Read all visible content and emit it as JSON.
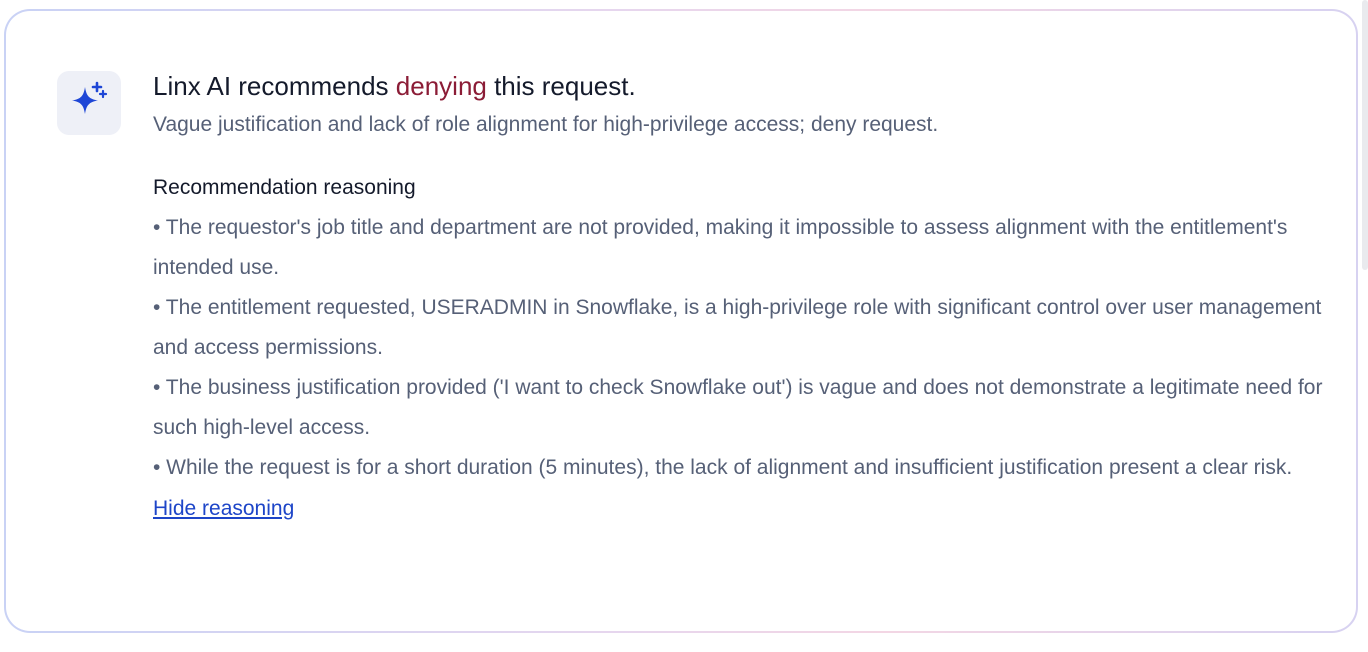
{
  "recommendation": {
    "headline_prefix": "Linx AI recommends ",
    "headline_verdict": "denying",
    "headline_suffix": " this request.",
    "summary": "Vague justification and lack of role alignment for high-privilege access; deny request.",
    "reasoning_title": "Recommendation reasoning",
    "reasons": [
      "• The requestor's job title and department are not provided, making it impossible to assess alignment with the entitlement's intended use.",
      "• The entitlement requested, USERADMIN in Snowflake, is a high-privilege role with significant control over user management and access permissions.",
      "• The business justification provided ('I want to check Snowflake out') is vague and does not demonstrate a legitimate need for such high-level access.",
      "• While the request is for a short duration (5 minutes), the lack of alignment and insufficient justification present a clear risk."
    ],
    "toggle_label": "Hide reasoning"
  },
  "icon": "sparkles-icon",
  "colors": {
    "verdict": "#8b1c36",
    "link": "#1d45c8",
    "icon": "#1e46d6",
    "icon_bg": "#eef0f7"
  }
}
